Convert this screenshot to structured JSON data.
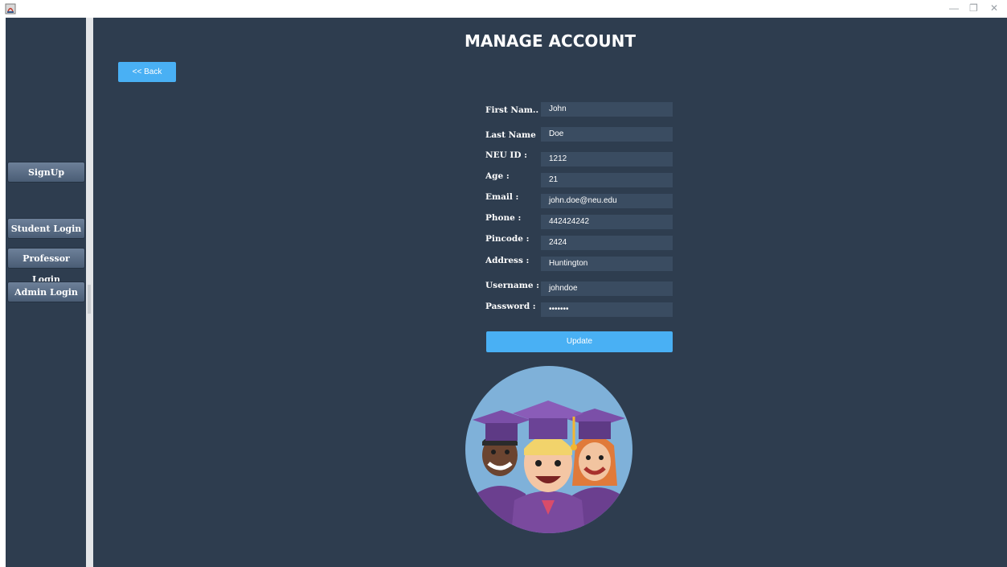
{
  "window": {
    "minimize_glyph": "—",
    "maximize_glyph": "❐",
    "close_glyph": "✕"
  },
  "sidebar": {
    "buttons": [
      {
        "label": "SignUp"
      },
      {
        "label": "Student Login"
      },
      {
        "label": "Professor Login"
      },
      {
        "label": "Admin Login"
      }
    ]
  },
  "main": {
    "title": "MANAGE ACCOUNT",
    "back_label": "<< Back",
    "update_label": "Update"
  },
  "form": {
    "fields": [
      {
        "label": "First Nam...",
        "value": "John"
      },
      {
        "label": "Last Name :",
        "value": "Doe"
      },
      {
        "label": "NEU ID :",
        "value": "1212"
      },
      {
        "label": "Age :",
        "value": "21"
      },
      {
        "label": "Email :",
        "value": "john.doe@neu.edu"
      },
      {
        "label": "Phone :",
        "value": "442424242"
      },
      {
        "label": "Pincode :",
        "value": "2424"
      },
      {
        "label": "Address :",
        "value": "Huntington"
      },
      {
        "label": "Username :",
        "value": "johndoe"
      },
      {
        "label": "Password :",
        "value": "•••••••"
      }
    ]
  },
  "colors": {
    "panel_bg": "#2e3d4f",
    "field_bg": "#3a4c61",
    "accent": "#49b0f4"
  }
}
